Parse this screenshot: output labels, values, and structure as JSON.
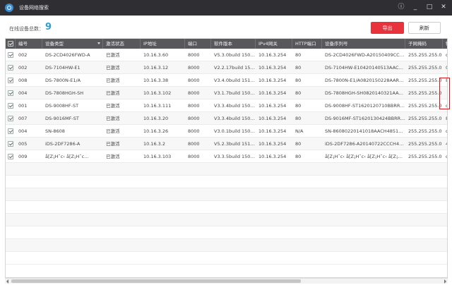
{
  "window": {
    "title": "设备网络搜索",
    "buttons": {
      "info": "ⓘ",
      "minimize": "_",
      "maximize": "□",
      "close": "✕"
    }
  },
  "toolbar": {
    "online_label": "在线设备总数：",
    "online_count": "9",
    "export_label": "导出",
    "refresh_label": "刷新"
  },
  "table": {
    "columns": [
      "编号",
      "设备类型",
      "激活状态",
      "IP地址",
      "端口",
      "软件版本",
      "IPv4网关",
      "HTTP端口",
      "设备序列号",
      "子网掩码",
      "物"
    ],
    "rows": [
      [
        "002",
        "DS-2CD4026FWD-A",
        "已激活",
        "10.16.3.60",
        "8000",
        "V5.3.0build 1503...",
        "10.16.3.254",
        "80",
        "DS-2CD4026FWD-A20150409CCCH...",
        "255.255.255.0",
        "c"
      ],
      [
        "002",
        "DS-7104HW-E1",
        "已激活",
        "10.16.3.12",
        "8000",
        "V2.2.17build 150...",
        "10.16.3.254",
        "80",
        "DS-7104HW-E10420140513AACH13...",
        "255.255.255.0",
        "0"
      ],
      [
        "008",
        "DS-7800N-E1/A",
        "已激活",
        "10.16.3.38",
        "8000",
        "V3.4.0build 1512...",
        "10.16.3.254",
        "80",
        "DS-7800N-E1/A0820150228AARR50...",
        "255.255.255.0",
        "8"
      ],
      [
        "004",
        "DS-7808HGH-SH",
        "已激活",
        "10.16.3.102",
        "8000",
        "V3.1.7build 1507...",
        "10.16.3.254",
        "80",
        "DS-7808HGH-SH0820140321AACH4...",
        "255.255.255.0",
        ""
      ],
      [
        "001",
        "DS-9008HF-ST",
        "已激活",
        "10.16.3.111",
        "8000",
        "V3.3.4build 1506...",
        "10.16.3.254",
        "80",
        "DS-9008HF-ST1620120710BBRR409...",
        "255.255.255.0",
        "c"
      ],
      [
        "007",
        "DS-9016MF-ST",
        "已激活",
        "10.16.3.20",
        "8000",
        "V3.3.4build 1506...",
        "10.16.3.254",
        "80",
        "DS-9016MF-ST1620130424BBRR42...",
        "255.255.255.0",
        "8"
      ],
      [
        "004",
        "SN-8608",
        "已激活",
        "10.16.3.26",
        "8000",
        "V3.0.1build 1505...",
        "10.16.3.254",
        "N/A",
        "SN-86080220141018AACH4851033...",
        "255.255.255.0",
        "c"
      ],
      [
        "005",
        "iDS-2DF7286-A",
        "已激活",
        "10.16.3.2",
        "8000",
        "V5.2.3build 1512...",
        "10.16.3.254",
        "80",
        "iDS-2DF7286-A20140722CCCH4735...",
        "255.255.255.0",
        "4"
      ],
      [
        "009",
        "å[Z¡Hˆc‹ å[Z¡Hˆc...",
        "已激活",
        "10.16.3.103",
        "8000",
        "V3.3.5build 1508...",
        "10.16.3.254",
        "80",
        "å[Z¡Hˆc‹ å[Z¡Hˆc‹ å[Z¡Hˆc‹ å[Z¡Hˆc...",
        "255.255.255.0",
        "c"
      ]
    ]
  }
}
